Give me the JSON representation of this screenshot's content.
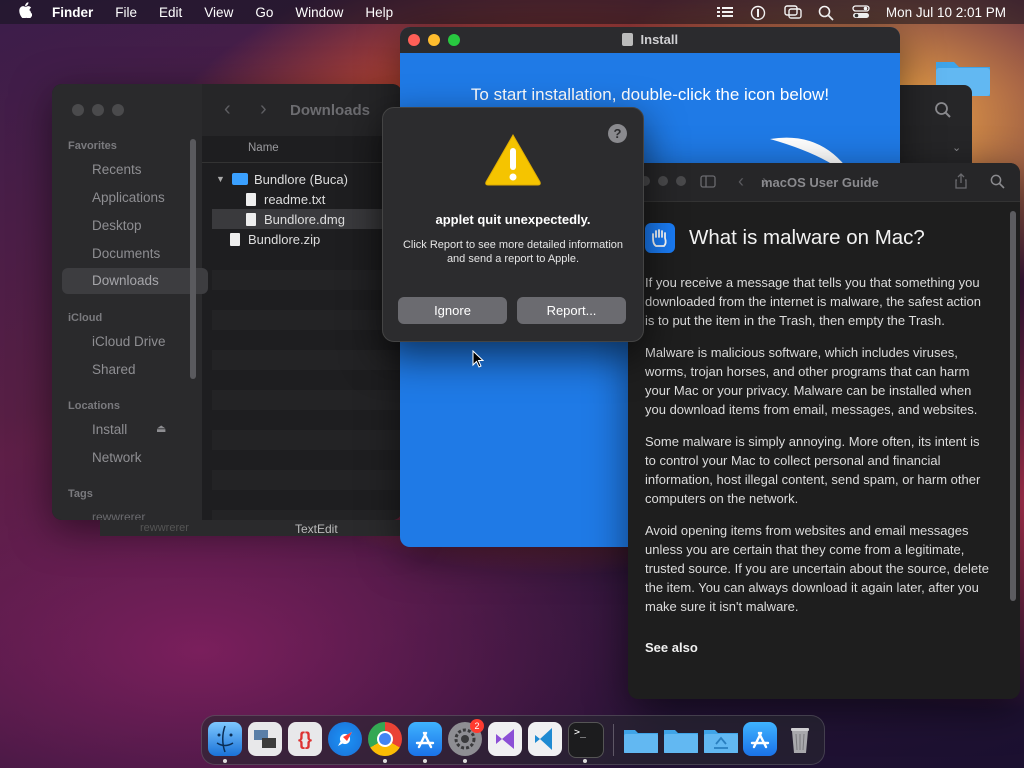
{
  "menubar": {
    "app": "Finder",
    "items": [
      "File",
      "Edit",
      "View",
      "Go",
      "Window",
      "Help"
    ],
    "clock": "Mon Jul 10  2:01 PM"
  },
  "finder": {
    "title": "Downloads",
    "sections": {
      "favorites": "Favorites",
      "icloud": "iCloud",
      "locations": "Locations",
      "tags": "Tags"
    },
    "favorites": [
      "Recents",
      "Applications",
      "Desktop",
      "Documents",
      "Downloads"
    ],
    "icloud_items": [
      "iCloud Drive",
      "Shared"
    ],
    "locations": [
      "Install",
      "Network"
    ],
    "tag_item": "rewwrerer",
    "column_name": "Name",
    "files": [
      "Bundlore (Buca)",
      "readme.txt",
      "Bundlore.dmg",
      "Bundlore.zip"
    ]
  },
  "textedit": {
    "label": "TextEdit",
    "left": "rewwrerer"
  },
  "install": {
    "title": "Install",
    "message": "To start installation, double-click the icon below!"
  },
  "dialog": {
    "help": "?",
    "heading": "applet quit unexpectedly.",
    "body": "Click Report to see more detailed information and send a report to Apple.",
    "ignore": "Ignore",
    "report": "Report..."
  },
  "guide": {
    "title": "macOS User Guide",
    "heading": "What is malware on Mac?",
    "p1": "If you receive a message that tells you that something you downloaded from the internet is malware, the safest action is to put the item in the Trash, then empty the Trash.",
    "p2": "Malware is malicious software, which includes viruses, worms, trojan horses, and other programs that can harm your Mac or your privacy. Malware can be installed when you download items from email, messages, and websites.",
    "p3": "Some malware is simply annoying. More often, its intent is to control your Mac to collect personal and financial information, host illegal content, send spam, or harm other computers on the network.",
    "p4": "Avoid opening items from websites and email messages unless you are certain that they come from a legitimate, trusted source. If you are uncertain about the source, delete the item. You can always download it again later, after you make sure it isn't malware.",
    "see_also": "See also"
  },
  "dock": {
    "apps": [
      "finder-icon",
      "preview-icon",
      "script-editor-icon",
      "safari-icon",
      "chrome-icon",
      "app-store-icon",
      "system-settings-icon",
      "visual-studio-icon",
      "vscode-icon",
      "terminal-icon",
      "folder-icon",
      "folder-icon",
      "downloads-folder-icon",
      "app-store-icon",
      "trash-icon"
    ],
    "settings_badge": "2"
  },
  "colors": {
    "accent": "#1f7ae6",
    "dialog_bg": "#2c2c2e",
    "warning": "#f5c400"
  }
}
